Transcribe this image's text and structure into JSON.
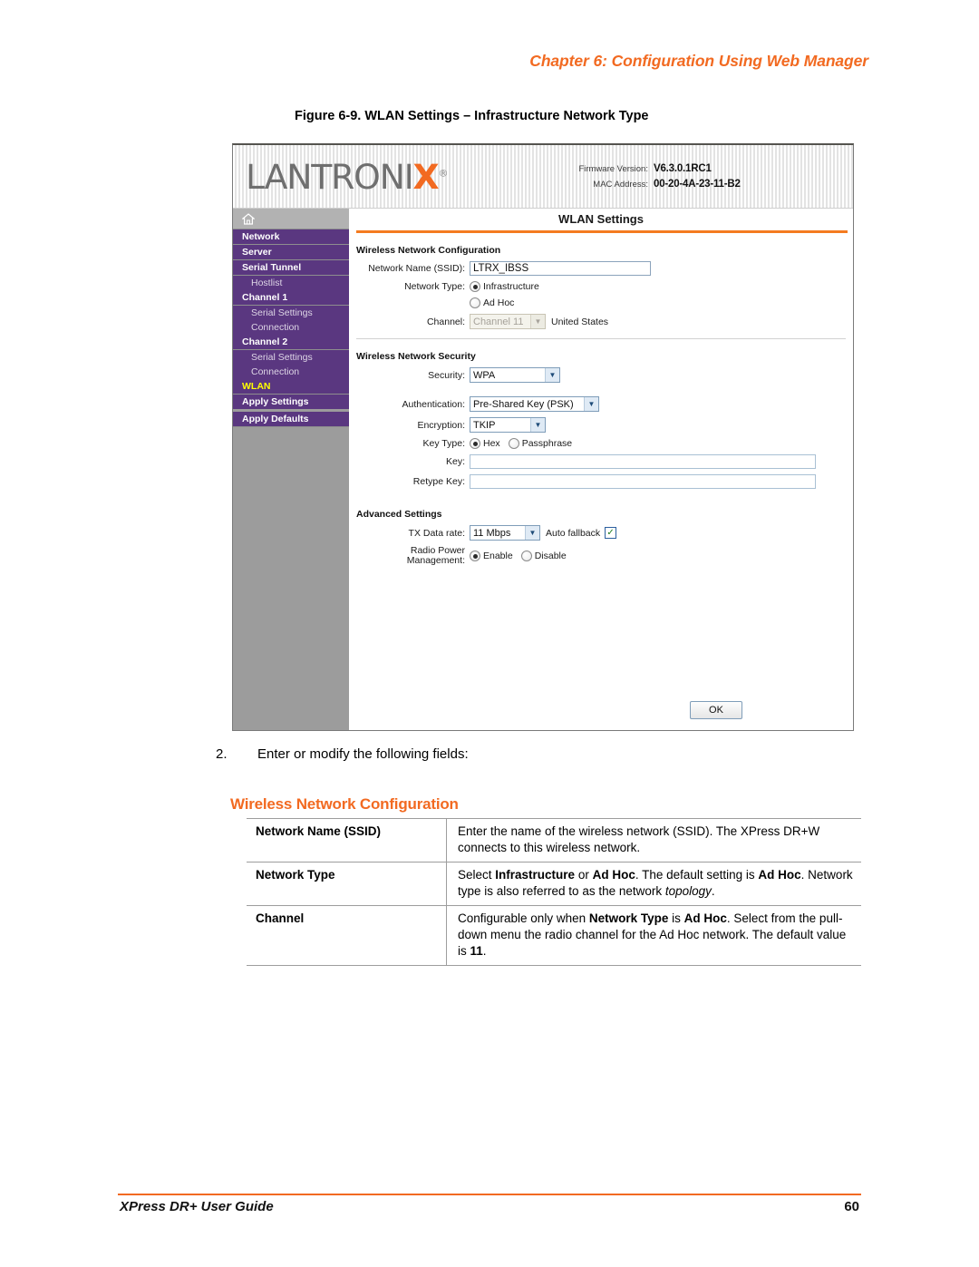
{
  "page": {
    "chapter_header": "Chapter 6: Configuration Using Web Manager",
    "figure_caption": "Figure 6-9. WLAN Settings – Infrastructure Network Type",
    "step_number": "2.",
    "step_text": "Enter or modify the following fields:",
    "accent_orange": "#f26a21",
    "footer_title": "XPress DR+ User Guide",
    "footer_page": "60"
  },
  "screenshot": {
    "logo": {
      "text_left": "LANTRONI",
      "text_x": "X",
      "registered": "®"
    },
    "firmware": {
      "label": "Firmware Version:",
      "value": "V6.3.0.1RC1"
    },
    "mac": {
      "label": "MAC Address:",
      "value": "00-20-4A-23-11-B2"
    },
    "page_title": "WLAN Settings",
    "nav": {
      "home_icon": "home-icon",
      "items": [
        {
          "label": "Network",
          "type": "main",
          "active": false
        },
        {
          "label": "Server",
          "type": "main",
          "active": false
        },
        {
          "label": "Serial Tunnel",
          "type": "main",
          "active": false
        },
        {
          "label": "Hostlist",
          "type": "sub",
          "active": false
        },
        {
          "label": "Channel 1",
          "type": "main",
          "active": false
        },
        {
          "label": "Serial Settings",
          "type": "sub",
          "active": false
        },
        {
          "label": "Connection",
          "type": "sub",
          "active": false
        },
        {
          "label": "Channel 2",
          "type": "main",
          "active": false
        },
        {
          "label": "Serial Settings",
          "type": "sub",
          "active": false
        },
        {
          "label": "Connection",
          "type": "sub",
          "active": false
        },
        {
          "label": "WLAN",
          "type": "main",
          "active": true
        },
        {
          "label": "Apply Settings",
          "type": "main",
          "active": false
        },
        {
          "label": "Apply Defaults",
          "type": "main",
          "active": false
        }
      ]
    },
    "wireless_network_configuration": {
      "section_title": "Wireless Network Configuration",
      "ssid_label": "Network Name (SSID):",
      "ssid_value": "LTRX_IBSS",
      "network_type_label": "Network Type:",
      "network_type_options": [
        "Infrastructure",
        "Ad Hoc"
      ],
      "network_type_selected": "Infrastructure",
      "channel_label": "Channel:",
      "channel_value": "Channel 11",
      "channel_disabled": true,
      "country": "United States"
    },
    "wireless_network_security": {
      "section_title": "Wireless Network Security",
      "security_label": "Security:",
      "security_value": "WPA",
      "authentication_label": "Authentication:",
      "authentication_value": "Pre-Shared Key (PSK)",
      "encryption_label": "Encryption:",
      "encryption_value": "TKIP",
      "key_type_label": "Key Type:",
      "key_type_options": [
        "Hex",
        "Passphrase"
      ],
      "key_type_selected": "Hex",
      "key_label": "Key:",
      "key_value": "",
      "retype_key_label": "Retype Key:",
      "retype_key_value": ""
    },
    "advanced_settings": {
      "section_title": "Advanced Settings",
      "tx_rate_label": "TX Data rate:",
      "tx_rate_value": "11 Mbps",
      "auto_fallback_label": "Auto fallback",
      "auto_fallback_checked": true,
      "radio_power_label_line1": "Radio Power",
      "radio_power_label_line2": "Management:",
      "radio_power_options": [
        "Enable",
        "Disable"
      ],
      "radio_power_selected": "Enable"
    },
    "ok_button": "OK"
  },
  "field_table": {
    "heading": "Wireless Network Configuration",
    "rows": [
      {
        "term": "Network Name (SSID)",
        "desc_html": "Enter the name of the wireless network (SSID). The XPress DR+W connects to this wireless network."
      },
      {
        "term": "Network Type",
        "desc_html": "Select <b class=\"bold\">Infrastructure</b> or <b class=\"bold\">Ad Hoc</b>. The default setting is <b class=\"bold\">Ad Hoc</b>. Network type is also referred to as the network <i class=\"ital\">topology</i>."
      },
      {
        "term": "Channel",
        "desc_html": "Configurable only when <b class=\"bold\">Network Type</b> is <b class=\"bold\">Ad Hoc</b>. Select from the pull-down menu the radio channel for the Ad Hoc network. The default value is <b class=\"bold\">11</b>."
      }
    ]
  }
}
